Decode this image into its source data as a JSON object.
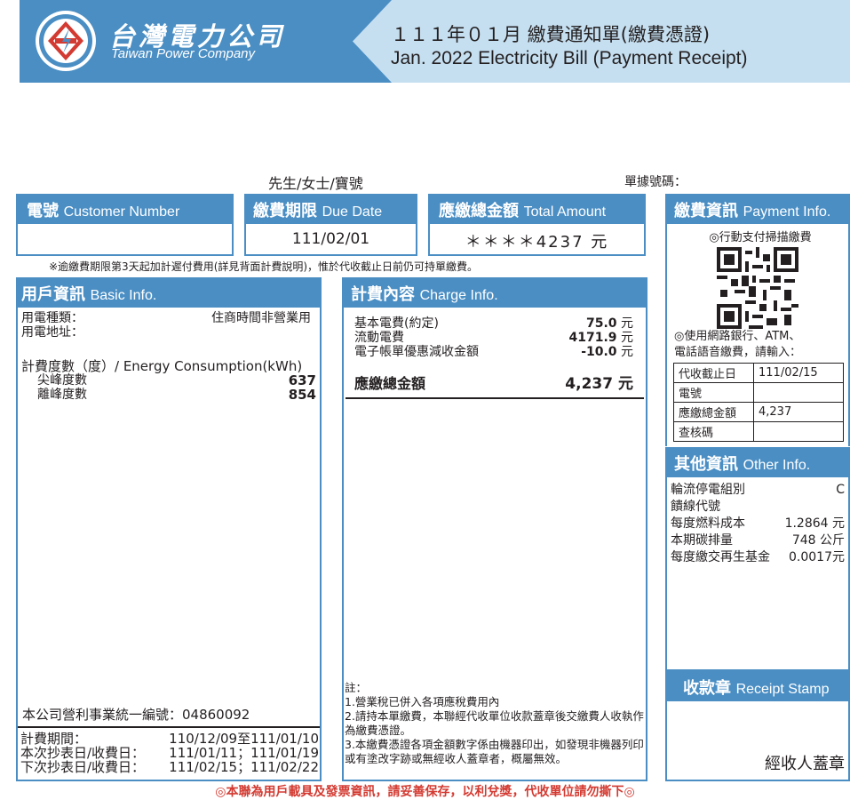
{
  "header": {
    "company_zh": "台灣電力公司",
    "company_en": "Taiwan Power Company",
    "title_zh": "１１１年０１月 繳費通知單(繳費憑證)",
    "title_en": "Jan. 2022 Electricity Bill (Payment Receipt)"
  },
  "greeting": "先生/女士/寶號",
  "receipt_label": "單據號碼：",
  "customer": {
    "label_zh": "電號",
    "label_en": "Customer Number",
    "value": ""
  },
  "due": {
    "label_zh": "繳費期限",
    "label_en": "Due Date",
    "value": "111/02/01"
  },
  "total": {
    "label_zh": "應繳總金額",
    "label_en": "Total Amount",
    "value": "＊＊＊＊4237 元"
  },
  "late_note": "※逾繳費期限第3天起加計遲付費用(詳見背面計費說明)，惟於代收截止日前仍可持單繳費。",
  "basic": {
    "label_zh": "用戶資訊",
    "label_en": "Basic Info.",
    "type_label": "用電種類：",
    "type_value": "住商時間非營業用",
    "address_label": "用電地址：",
    "consumption_label": "計費度數（度）/ Energy Consumption(kWh)",
    "peak_label": "尖峰度數",
    "peak_value": "637",
    "offpeak_label": "離峰度數",
    "offpeak_value": "854",
    "company_id": "本公司營利事業統一編號：04860092",
    "period_label": "計費期間：",
    "period_value": "110/12/09至111/01/10",
    "this_read_label": "本次抄表日/收費日：",
    "this_read_value": "111/01/11；111/01/19",
    "next_read_label": "下次抄表日/收費日：",
    "next_read_value": "111/02/15；111/02/22"
  },
  "charge": {
    "label_zh": "計費內容",
    "label_en": "Charge Info.",
    "items": [
      {
        "label": "基本電費(約定)",
        "value": "75.0",
        "unit": "元"
      },
      {
        "label": "流動電費",
        "value": "4171.9",
        "unit": "元"
      },
      {
        "label": "電子帳單優惠減收金額",
        "value": "-10.0",
        "unit": "元"
      }
    ],
    "total_label": "應繳總金額",
    "total_value": "4,237 元",
    "notes": [
      "註：",
      "1.營業稅已併入各項應稅費用內",
      "2.請持本單繳費，本聯經代收單位收款蓋章後交繳費人收執作為繳費憑證。",
      "3.本繳費憑證各項金額數字係由機器印出，如發現非機器列印或有塗改字跡或無經收人蓋章者，概屬無效。"
    ]
  },
  "payment": {
    "label_zh": "繳費資訊",
    "label_en": "Payment Info.",
    "qr_label": "◎行動支付掃描繳費",
    "note_line1": "◎使用網路銀行、ATM、",
    "note_line2": "電話語音繳費，請輸入：",
    "rows": [
      {
        "label": "代收截止日",
        "value": "111/02/15"
      },
      {
        "label": "電號",
        "value": ""
      },
      {
        "label": "應繳總金額",
        "value": "4,237"
      },
      {
        "label": "查核碼",
        "value": ""
      }
    ]
  },
  "other": {
    "label_zh": "其他資訊",
    "label_en": "Other Info.",
    "rows": [
      {
        "label": "輪流停電組別",
        "value": "C"
      },
      {
        "label": "饋線代號",
        "value": ""
      },
      {
        "label": "每度燃料成本",
        "value": "1.2864 元"
      },
      {
        "label": "本期碳排量",
        "value": "748 公斤"
      },
      {
        "label": "每度繳交再生基金",
        "value": "0.0017元"
      }
    ]
  },
  "stamp": {
    "label_zh": "收款章",
    "label_en": "Receipt Stamp",
    "signer": "經收人蓋章"
  },
  "footer": "◎本聯為用戶載具及發票資訊，請妥善保存，以利兌獎，代收單位請勿撕下◎"
}
